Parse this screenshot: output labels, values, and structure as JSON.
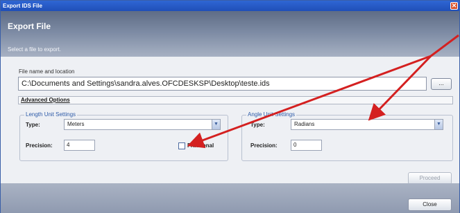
{
  "window": {
    "title": "Export IDS File",
    "close_glyph": "✕"
  },
  "header": {
    "title": "Export File",
    "subtitle": "Select a file to export."
  },
  "file": {
    "label": "File name and location",
    "path_value": "C:\\Documents and Settings\\sandra.alves.OFCDESKSP\\Desktop\\teste.ids",
    "browse_label": "..."
  },
  "advanced": {
    "label": "Advanced Options"
  },
  "length_settings": {
    "title": "Length Unit Settings",
    "type_label": "Type:",
    "type_value": "Meters",
    "precision_label": "Precision:",
    "precision_value": "4",
    "fractional_label": "Fractional",
    "fractional_checked": false
  },
  "angle_settings": {
    "title": "Angle Unit Settings",
    "type_label": "Type:",
    "type_value": "Radians",
    "precision_label": "Precision:",
    "precision_value": "0"
  },
  "buttons": {
    "proceed": "Proceed",
    "close": "Close"
  },
  "icons": {
    "dropdown": "chevron-down-icon",
    "window_close": "close-icon"
  },
  "colors": {
    "arrow": "#d42020",
    "title_bar": "#2f66d4",
    "group_title": "#2d5aa8"
  }
}
